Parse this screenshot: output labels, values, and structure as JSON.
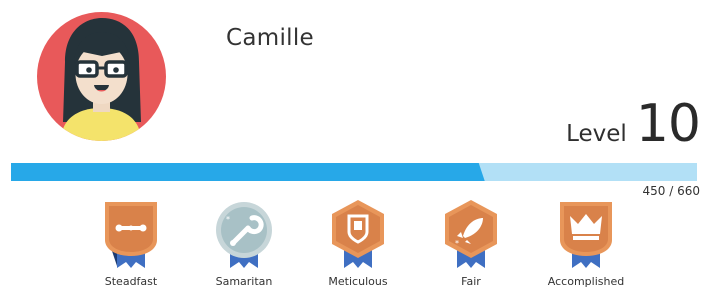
{
  "profile": {
    "name": "Camille",
    "avatar_icon": "avatar-girl-glasses-icon",
    "avatar_bg": "#e8595a"
  },
  "level": {
    "label": "Level",
    "value": "10"
  },
  "xp": {
    "current": 450,
    "max": 660,
    "text": "450 / 660",
    "fill_color": "#27a8e8",
    "track_color": "#b2e0f6"
  },
  "badges": [
    {
      "label": "Steadfast",
      "icon": "chain-link-icon",
      "shape": "shield",
      "color": "#e8965a",
      "earned": true
    },
    {
      "label": "Samaritan",
      "icon": "wrench-icon",
      "shape": "circle",
      "color": "#a8c1c6",
      "earned": false
    },
    {
      "label": "Meticulous",
      "icon": "shield-emblem-icon",
      "shape": "hexagon",
      "color": "#e8965a",
      "earned": true
    },
    {
      "label": "Fair",
      "icon": "rocket-icon",
      "shape": "hexagon",
      "color": "#e8965a",
      "earned": true
    },
    {
      "label": "Accomplished",
      "icon": "crown-icon",
      "shape": "shield",
      "color": "#e8965a",
      "earned": true
    }
  ]
}
